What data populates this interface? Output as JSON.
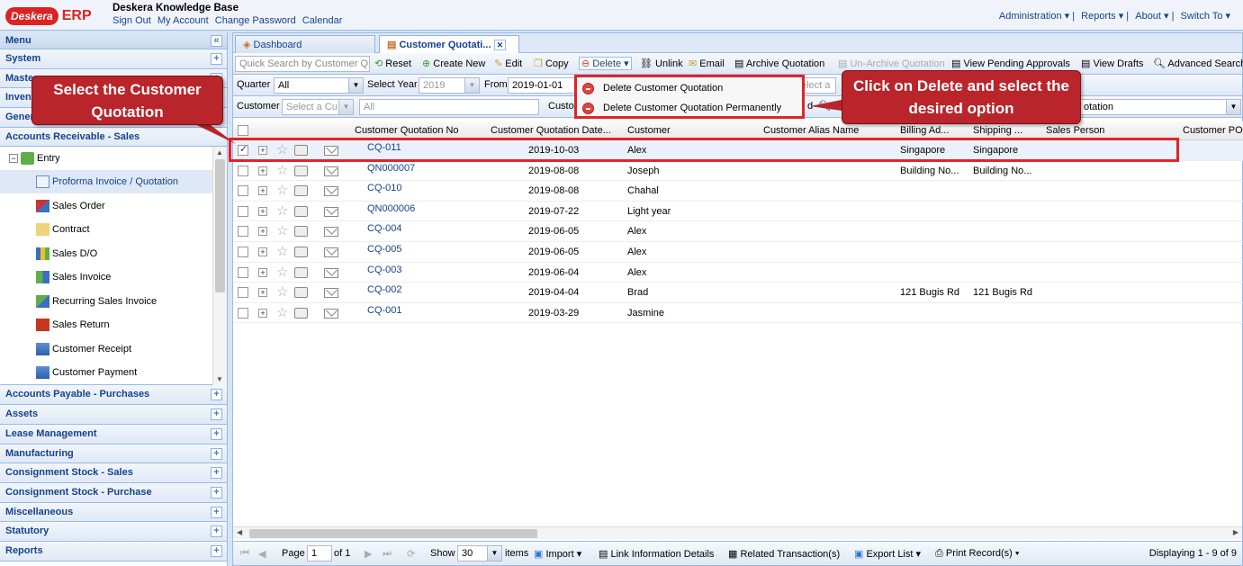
{
  "header": {
    "logo_text": "Deskera",
    "logo_erp": "ERP",
    "title": "Deskera Knowledge Base",
    "links": [
      "Sign Out",
      "My Account",
      "Change Password",
      "Calendar"
    ],
    "nav": [
      "Administration",
      "Reports",
      "About",
      "Switch To"
    ]
  },
  "sidebar": {
    "menu_label": "Menu",
    "top_sections": [
      "System",
      "Masters",
      "Inventory",
      "General Ledger / Cash"
    ],
    "open_section": "Accounts Receivable - Sales",
    "entry_label": "Entry",
    "items": [
      "Proforma Invoice / Quotation",
      "Sales Order",
      "Contract",
      "Sales D/O",
      "Sales Invoice",
      "Recurring Sales Invoice",
      "Sales Return",
      "Customer Receipt",
      "Customer Payment"
    ],
    "bottom_sections": [
      "Accounts Payable - Purchases",
      "Assets",
      "Lease Management",
      "Manufacturing",
      "Consignment Stock - Sales",
      "Consignment Stock - Purchase",
      "Miscellaneous",
      "Statutory",
      "Reports"
    ]
  },
  "tabs": [
    "Dashboard",
    "Customer Quotati..."
  ],
  "toolbar": {
    "search_placeholder": "Quick Search by Customer Q",
    "reset": "Reset",
    "create": "Create New",
    "edit": "Edit",
    "copy": "Copy",
    "delete": "Delete",
    "unlink": "Unlink",
    "email": "Email",
    "archive": "Archive Quotation",
    "unarchive": "Un-Archive Quotation",
    "pending": "View Pending Approvals",
    "drafts": "View Drafts",
    "advanced": "Advanced Search"
  },
  "filters": {
    "quarter_label": "Quarter",
    "quarter_value": "All",
    "year_label": "Select Year",
    "year_value": "2019",
    "from_label": "From",
    "from_value": "2019-01-01",
    "customer_label": "Customer",
    "customer_placeholder": "Select a Cu",
    "all_value": "All",
    "custo_label": "Custo",
    "select_placeholder": "elect a",
    "d_label": "d",
    "otation_text": "otation"
  },
  "dropdown": {
    "item1": "Delete Customer Quotation",
    "item2": "Delete Customer Quotation Permanently"
  },
  "columns": [
    "Customer Quotation No",
    "Customer Quotation Date...",
    "Customer",
    "Customer Alias Name",
    "Billing Ad...",
    "Shipping ...",
    "Sales Person",
    "Customer PO"
  ],
  "rows": [
    {
      "no": "CQ-011",
      "date": "2019-10-03",
      "customer": "Alex",
      "billing": "Singapore",
      "shipping": "Singapore",
      "checked": true
    },
    {
      "no": "QN000007",
      "date": "2019-08-08",
      "customer": "Joseph",
      "billing": "Building No...",
      "shipping": "Building No..."
    },
    {
      "no": "CQ-010",
      "date": "2019-08-08",
      "customer": "Chahal",
      "billing": "",
      "shipping": ""
    },
    {
      "no": "QN000006",
      "date": "2019-07-22",
      "customer": "Light year",
      "billing": "",
      "shipping": ""
    },
    {
      "no": "CQ-004",
      "date": "2019-06-05",
      "customer": "Alex",
      "billing": "",
      "shipping": ""
    },
    {
      "no": "CQ-005",
      "date": "2019-06-05",
      "customer": "Alex",
      "billing": "",
      "shipping": ""
    },
    {
      "no": "CQ-003",
      "date": "2019-06-04",
      "customer": "Alex",
      "billing": "",
      "shipping": ""
    },
    {
      "no": "CQ-002",
      "date": "2019-04-04",
      "customer": "Brad",
      "billing": "121 Bugis Rd",
      "shipping": "121 Bugis Rd"
    },
    {
      "no": "CQ-001",
      "date": "2019-03-29",
      "customer": "Jasmine",
      "billing": "",
      "shipping": ""
    }
  ],
  "pager": {
    "page_label": "Page",
    "page_value": "1",
    "of": "of 1",
    "show": "Show",
    "show_value": "30",
    "items": "items",
    "import": "Import",
    "link_info": "Link Information Details",
    "related": "Related Transaction(s)",
    "export": "Export List",
    "print": "Print Record(s)",
    "displaying": "Displaying 1 - 9 of 9"
  },
  "callouts": {
    "left": "Select the Customer Quotation",
    "right": "Click on Delete and select the desired option"
  },
  "colors": {
    "callout": "#b9252b",
    "highlight": "#e2232a",
    "link": "#15428b"
  }
}
